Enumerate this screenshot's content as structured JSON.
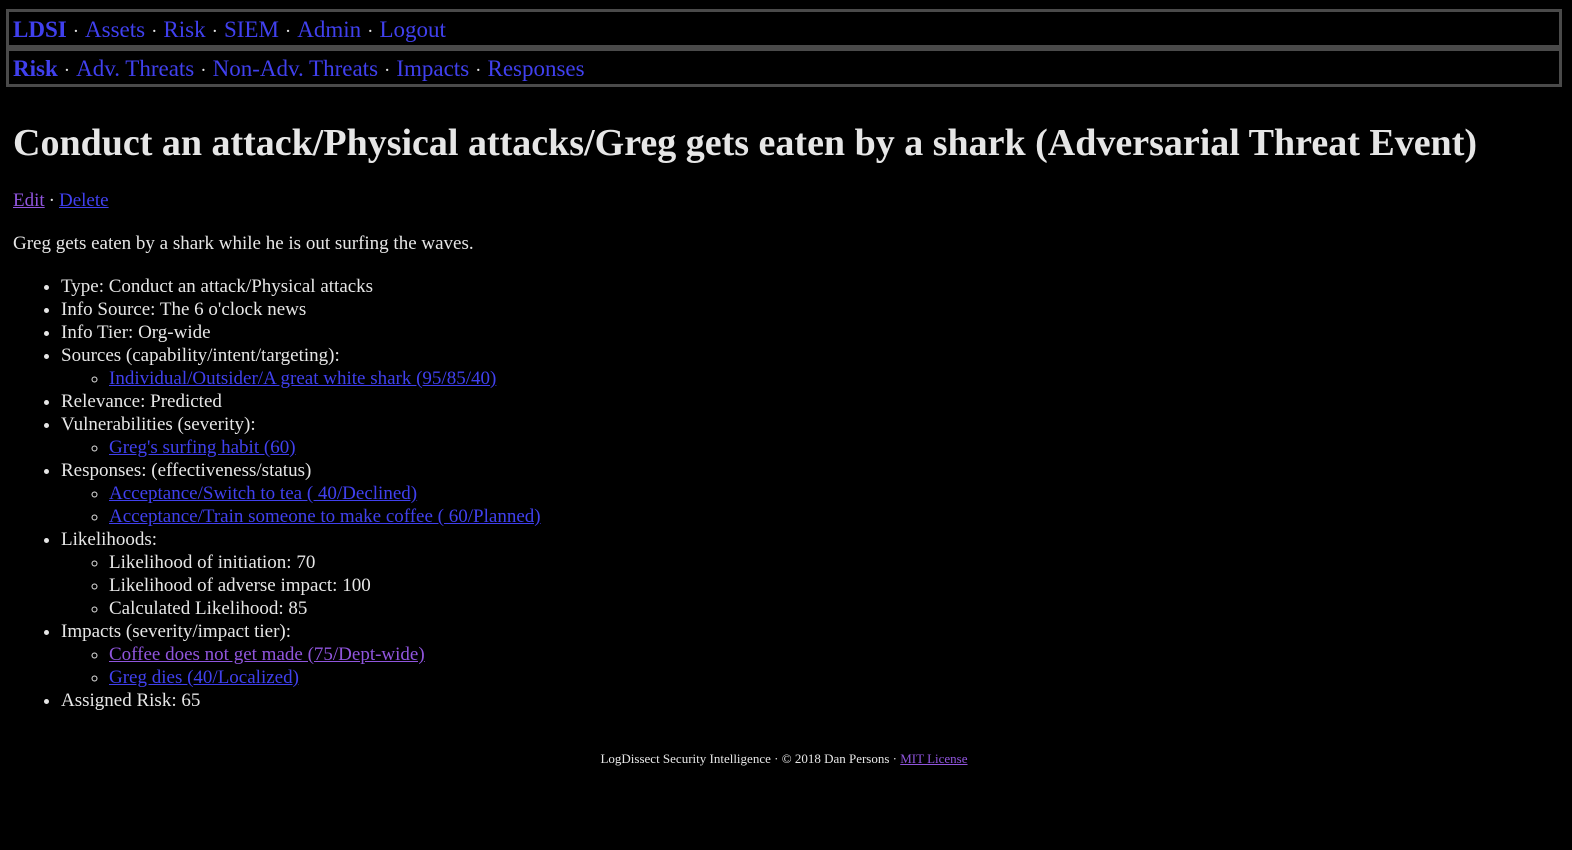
{
  "nav_primary": {
    "brand": "LDSI",
    "items": [
      "Assets",
      "Risk",
      "SIEM",
      "Admin",
      "Logout"
    ]
  },
  "nav_secondary": {
    "brand": "Risk",
    "items": [
      "Adv. Threats",
      "Non-Adv. Threats",
      "Impacts",
      "Responses"
    ]
  },
  "separator": "·",
  "page": {
    "title": "Conduct an attack/Physical attacks/Greg gets eaten by a shark (Adversarial Threat Event)",
    "actions": {
      "edit": "Edit",
      "delete": "Delete"
    },
    "description": "Greg gets eaten by a shark while he is out surfing the waves."
  },
  "details": {
    "type": "Type: Conduct an attack/Physical attacks",
    "info_source": "Info Source: The 6 o'clock news",
    "info_tier": "Info Tier: Org-wide",
    "sources_label": "Sources (capability/intent/targeting):",
    "sources": [
      "Individual/Outsider/A great white shark (95/85/40)"
    ],
    "relevance": "Relevance: Predicted",
    "vulnerabilities_label": "Vulnerabilities (severity):",
    "vulnerabilities": [
      "Greg's surfing habit (60)"
    ],
    "responses_label": "Responses: (effectiveness/status)",
    "responses": [
      "Acceptance/Switch to tea ( 40/Declined)",
      "Acceptance/Train someone to make coffee ( 60/Planned)"
    ],
    "likelihoods_label": "Likelihoods:",
    "likelihoods": [
      "Likelihood of initiation: 70",
      "Likelihood of adverse impact: 100",
      "Calculated Likelihood: 85"
    ],
    "impacts_label": "Impacts (severity/impact tier):",
    "impacts": [
      "Coffee does not get made (75/Dept-wide)",
      "Greg dies (40/Localized)"
    ],
    "assigned_risk": "Assigned Risk: 65"
  },
  "footer": {
    "text": "LogDissect Security Intelligence · © 2018 Dan Persons ·",
    "license_link": "MIT License"
  },
  "colors": {
    "background": "#000000",
    "text": "#e6e6e6",
    "link": "#4040ee",
    "link_visited": "#9055dd",
    "nav_border": "#4a4a4a"
  }
}
